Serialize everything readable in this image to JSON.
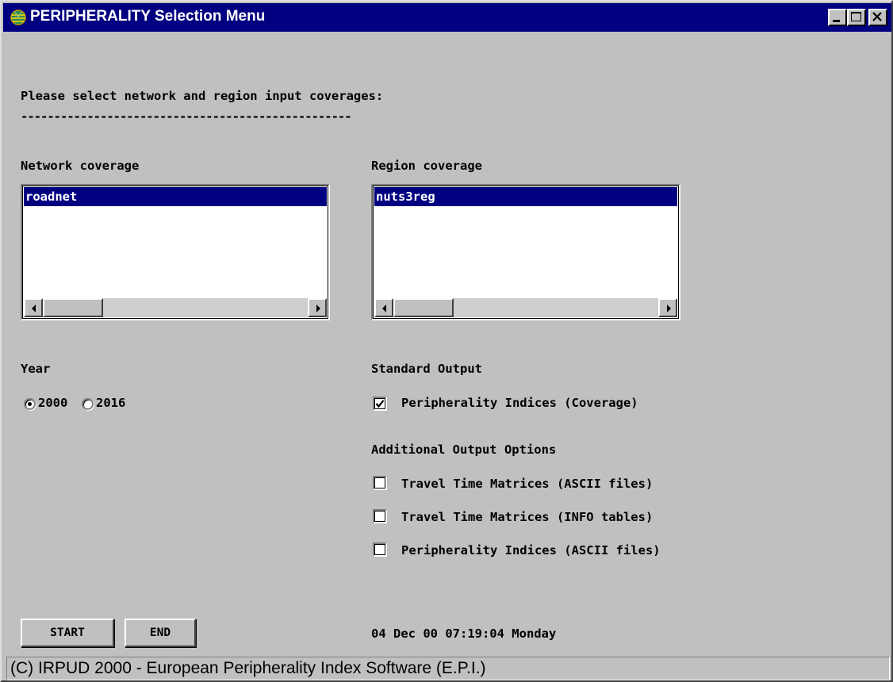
{
  "window": {
    "title": "PERIPHERALITY Selection Menu",
    "colors": {
      "titlebar": "#000080",
      "face": "#c0c0c0",
      "selection": "#000080"
    }
  },
  "prompt": {
    "text": "Please select network and region input coverages:",
    "underline": "--------------------------------------------------"
  },
  "network": {
    "label": "Network coverage",
    "items": [
      "roadnet"
    ],
    "selected": "roadnet"
  },
  "region": {
    "label": "Region coverage",
    "items": [
      "nuts3reg"
    ],
    "selected": "nuts3reg"
  },
  "year": {
    "label": "Year",
    "options": [
      {
        "label": "2000",
        "checked": true
      },
      {
        "label": "2016",
        "checked": false
      }
    ]
  },
  "standard_output": {
    "label": "Standard Output",
    "options": [
      {
        "label": "Peripherality Indices (Coverage)",
        "checked": true
      }
    ]
  },
  "additional_output": {
    "label": "Additional Output Options",
    "options": [
      {
        "label": "Travel Time Matrices (ASCII files)",
        "checked": false
      },
      {
        "label": "Travel Time Matrices (INFO tables)",
        "checked": false
      },
      {
        "label": "Peripherality Indices (ASCII files)",
        "checked": false
      }
    ]
  },
  "buttons": {
    "start": "START",
    "end": "END"
  },
  "datetime": "04 Dec 00 07:19:04 Monday",
  "status": "(C) IRPUD 2000 - European Peripherality Index Software (E.P.I.)"
}
